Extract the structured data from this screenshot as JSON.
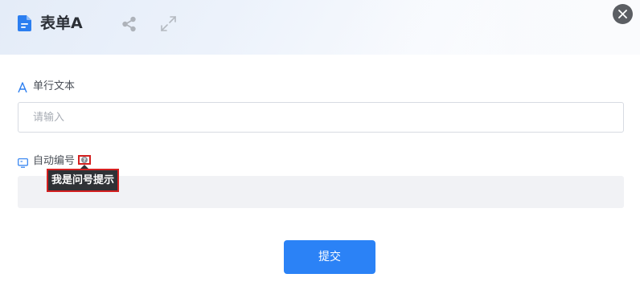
{
  "header": {
    "title": "表单A",
    "icons": {
      "form": "form-document-icon",
      "share": "share-icon",
      "expand": "expand-icon",
      "close": "close-icon"
    }
  },
  "fields": [
    {
      "label": "单行文本",
      "icon": "text-a-icon",
      "placeholder": "请输入",
      "value": ""
    },
    {
      "label": "自动编号",
      "icon": "auto-number-icon",
      "help_icon": "question-mark-icon",
      "tooltip": "我是问号提示",
      "value": ""
    }
  ],
  "submit_label": "提交",
  "colors": {
    "accent": "#2b82f6",
    "title_text": "#2b2f36",
    "label_text": "#4a4f57",
    "tooltip_bg": "#2f3236",
    "highlight_border": "#d42020",
    "readonly_bg": "#f1f2f5"
  }
}
